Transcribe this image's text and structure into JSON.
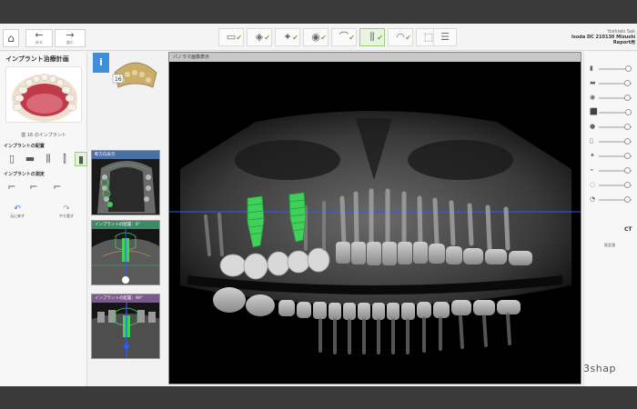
{
  "toolbar": {
    "home_icon": "home-icon",
    "back_label": "戻る",
    "forward_label": "進む",
    "steps": [
      {
        "icon": "scan-icon",
        "done": true
      },
      {
        "icon": "align-icon",
        "done": true
      },
      {
        "icon": "tooth-design-icon",
        "done": true
      },
      {
        "icon": "crown-icon",
        "done": true
      },
      {
        "icon": "implant-icon",
        "done": true,
        "active": true
      },
      {
        "icon": "guide-icon",
        "done": true
      },
      {
        "icon": "sleeve-icon",
        "done": true
      },
      {
        "icon": "export-icon",
        "done": false
      }
    ]
  },
  "user": {
    "name": "Yoshiaki Sak",
    "case": "Isoda DC 210130 Mizushin",
    "case_sub": "Report用"
  },
  "left_panel": {
    "title": "インプラント治療計画",
    "implant_count_prefix": "歯 ",
    "implant_count_value": "16",
    "implant_count_suffix": " のインプラント",
    "placement_header": "インプラントの配置",
    "measure_header": "インプラントの測定",
    "undo_label": "元に戻す",
    "redo_label": "やり直す"
  },
  "thumbnails": {
    "info_label": "i",
    "tooth_label": "16",
    "cross_header": "断方向表示",
    "view0_header": "インプラントの配置：0°",
    "view90_header": "インプラントの配置：90°"
  },
  "viewport": {
    "header": "パノラマ画像表示",
    "colors": {
      "implant": "#3fd15a",
      "guide_line": "#2a5cff"
    }
  },
  "right_panel": {
    "sliders": [
      {
        "icon": "tooth-slider-icon",
        "level": 0.9
      },
      {
        "icon": "crown-slider-icon",
        "level": 0.85
      },
      {
        "icon": "gum-slider-icon",
        "level": 0.85
      },
      {
        "icon": "implant-slider-icon",
        "level": 0.9
      },
      {
        "icon": "bone-slider-icon",
        "level": 0.85
      },
      {
        "icon": "cylinder-slider-icon",
        "level": 0.85
      },
      {
        "icon": "nerve-slider-icon",
        "level": 0.85
      },
      {
        "icon": "drill-slider-icon",
        "level": 0.85
      },
      {
        "icon": "sleeve-slider-icon",
        "level": 0.85
      },
      {
        "icon": "ct-slider-icon",
        "level": 0.85
      }
    ],
    "ct_label": "CT",
    "default_label": "既定値"
  },
  "brand": "3shap"
}
